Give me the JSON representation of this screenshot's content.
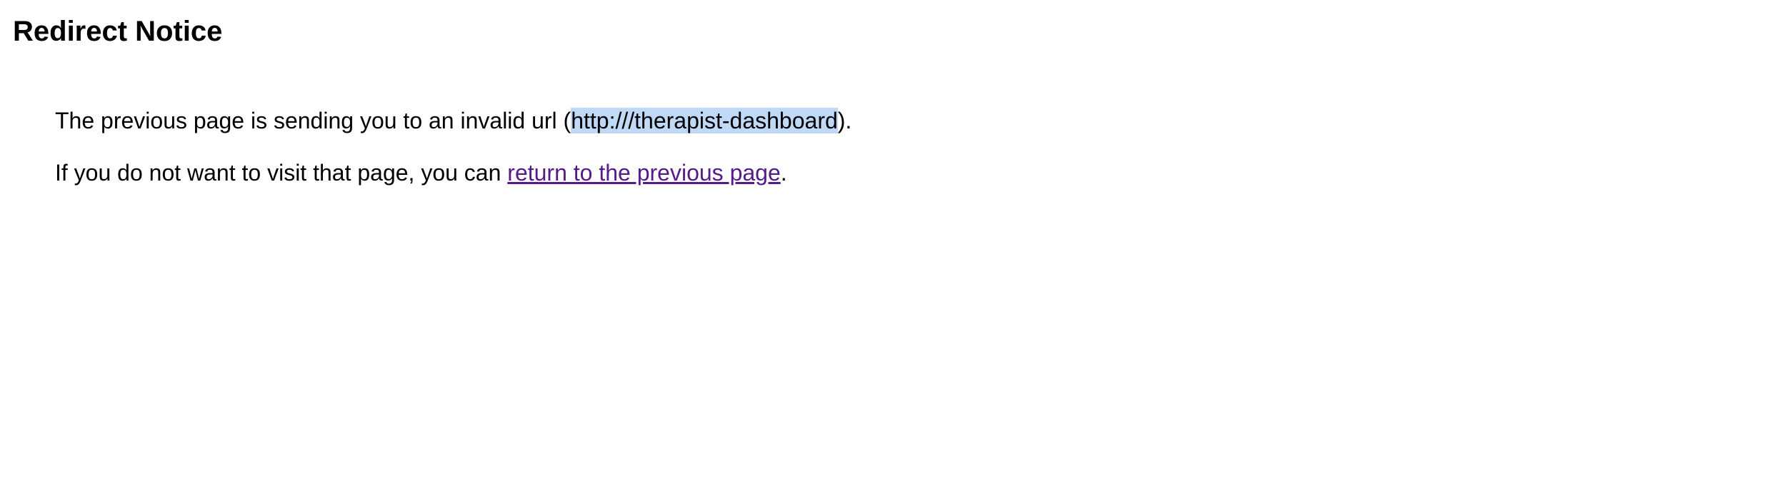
{
  "header": {
    "title": "Redirect Notice"
  },
  "notice": {
    "line1_prefix": "The previous page is sending you to an invalid url (",
    "invalid_url": "http:///therapist-dashboard",
    "line1_suffix": ").",
    "line2_prefix": "If you do not want to visit that page, you can ",
    "return_link": "return to the previous page",
    "line2_suffix": "."
  },
  "colors": {
    "link_visited": "#551a8b",
    "selection_highlight": "#bfd9f7",
    "background": "#ffffff",
    "text": "#000000"
  }
}
